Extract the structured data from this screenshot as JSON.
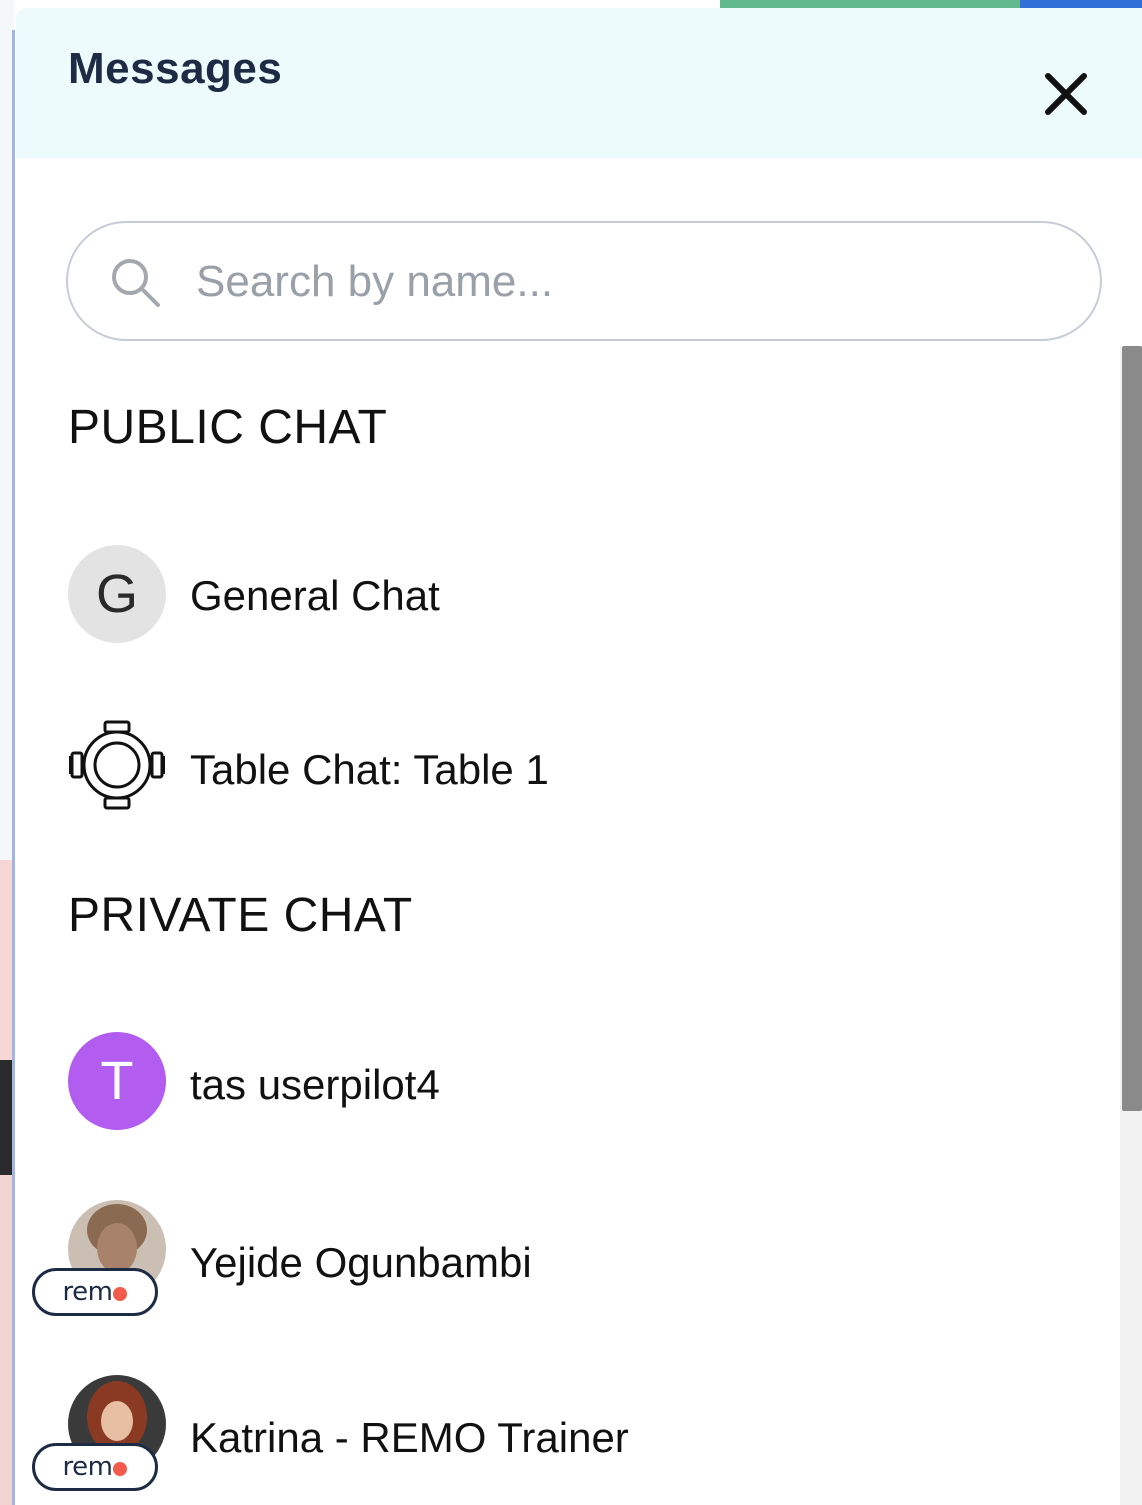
{
  "panel": {
    "title": "Messages",
    "close_icon": "close-icon"
  },
  "search": {
    "placeholder": "Search by name...",
    "value": "",
    "icon": "search-icon"
  },
  "public_chat": {
    "heading": "PUBLIC CHAT",
    "items": [
      {
        "initial": "G",
        "name": "General Chat",
        "icon": "letter-avatar"
      },
      {
        "name": "Table Chat: Table 1",
        "icon": "table-icon"
      }
    ]
  },
  "private_chat": {
    "heading": "PRIVATE CHAT",
    "items": [
      {
        "initial": "T",
        "name": "tas userpilot4",
        "avatar_color": "#b35cf0"
      },
      {
        "name": "Yejide Ogunbambi",
        "badge": "remo"
      },
      {
        "name": "Katrina - REMO Trainer",
        "badge": "remo"
      }
    ]
  },
  "colors": {
    "header_bg": "#eefbfd",
    "title": "#1e2b44",
    "avatar_purple": "#b35cf0",
    "avatar_gray": "#e3e3e3",
    "remo_accent": "#f25a4c"
  }
}
